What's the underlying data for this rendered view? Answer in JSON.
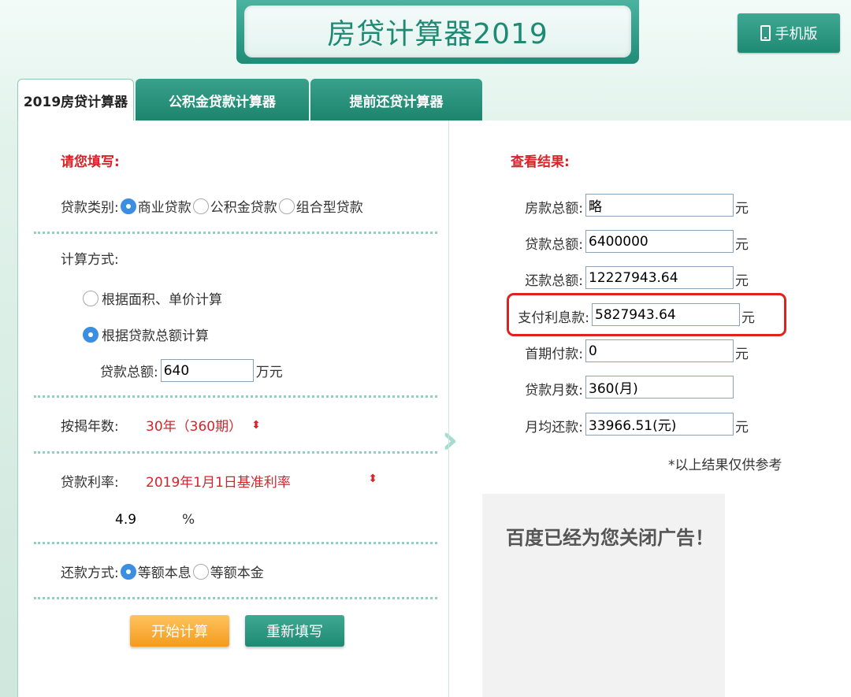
{
  "header": {
    "title": "房贷计算器2019",
    "mobile_label": "手机版"
  },
  "tabs": [
    {
      "label": "2019房贷计算器"
    },
    {
      "label": "公积金贷款计算器"
    },
    {
      "label": "提前还贷计算器"
    }
  ],
  "form": {
    "hint": "请您填写:",
    "loan_type_label": "贷款类别:",
    "loan_types": [
      "商业贷款",
      "公积金贷款",
      "组合型贷款"
    ],
    "calc_method_label": "计算方式:",
    "calc_methods": [
      "根据面积、单价计算",
      "根据贷款总额计算"
    ],
    "loan_total_label": "贷款总额:",
    "loan_total_value": "640",
    "loan_total_unit": "万元",
    "years_label": "按揭年数:",
    "years_value": "30年（360期）",
    "rate_label": "贷款利率:",
    "rate_value": "2019年1月1日基准利率",
    "rate_number": "4.9",
    "rate_unit": "%",
    "repay_label": "还款方式:",
    "repay_methods": [
      "等额本息",
      "等额本金"
    ],
    "calc_button": "开始计算",
    "reset_button": "重新填写"
  },
  "results": {
    "hint": "查看结果:",
    "house_total_label": "房款总额:",
    "house_total_value": "略",
    "loan_total_label": "贷款总额:",
    "loan_total_value": "6400000",
    "repay_total_label": "还款总额:",
    "repay_total_value": "12227943.64",
    "interest_label": "支付利息款:",
    "interest_value": "5827943.64",
    "down_payment_label": "首期付款:",
    "down_payment_value": "0",
    "months_label": "贷款月数:",
    "months_value": "360(月)",
    "monthly_label": "月均还款:",
    "monthly_value": "33966.51(元)",
    "unit": "元",
    "note": "*以上结果仅供参考"
  },
  "ad": {
    "text": "百度已经为您关闭广告！"
  }
}
